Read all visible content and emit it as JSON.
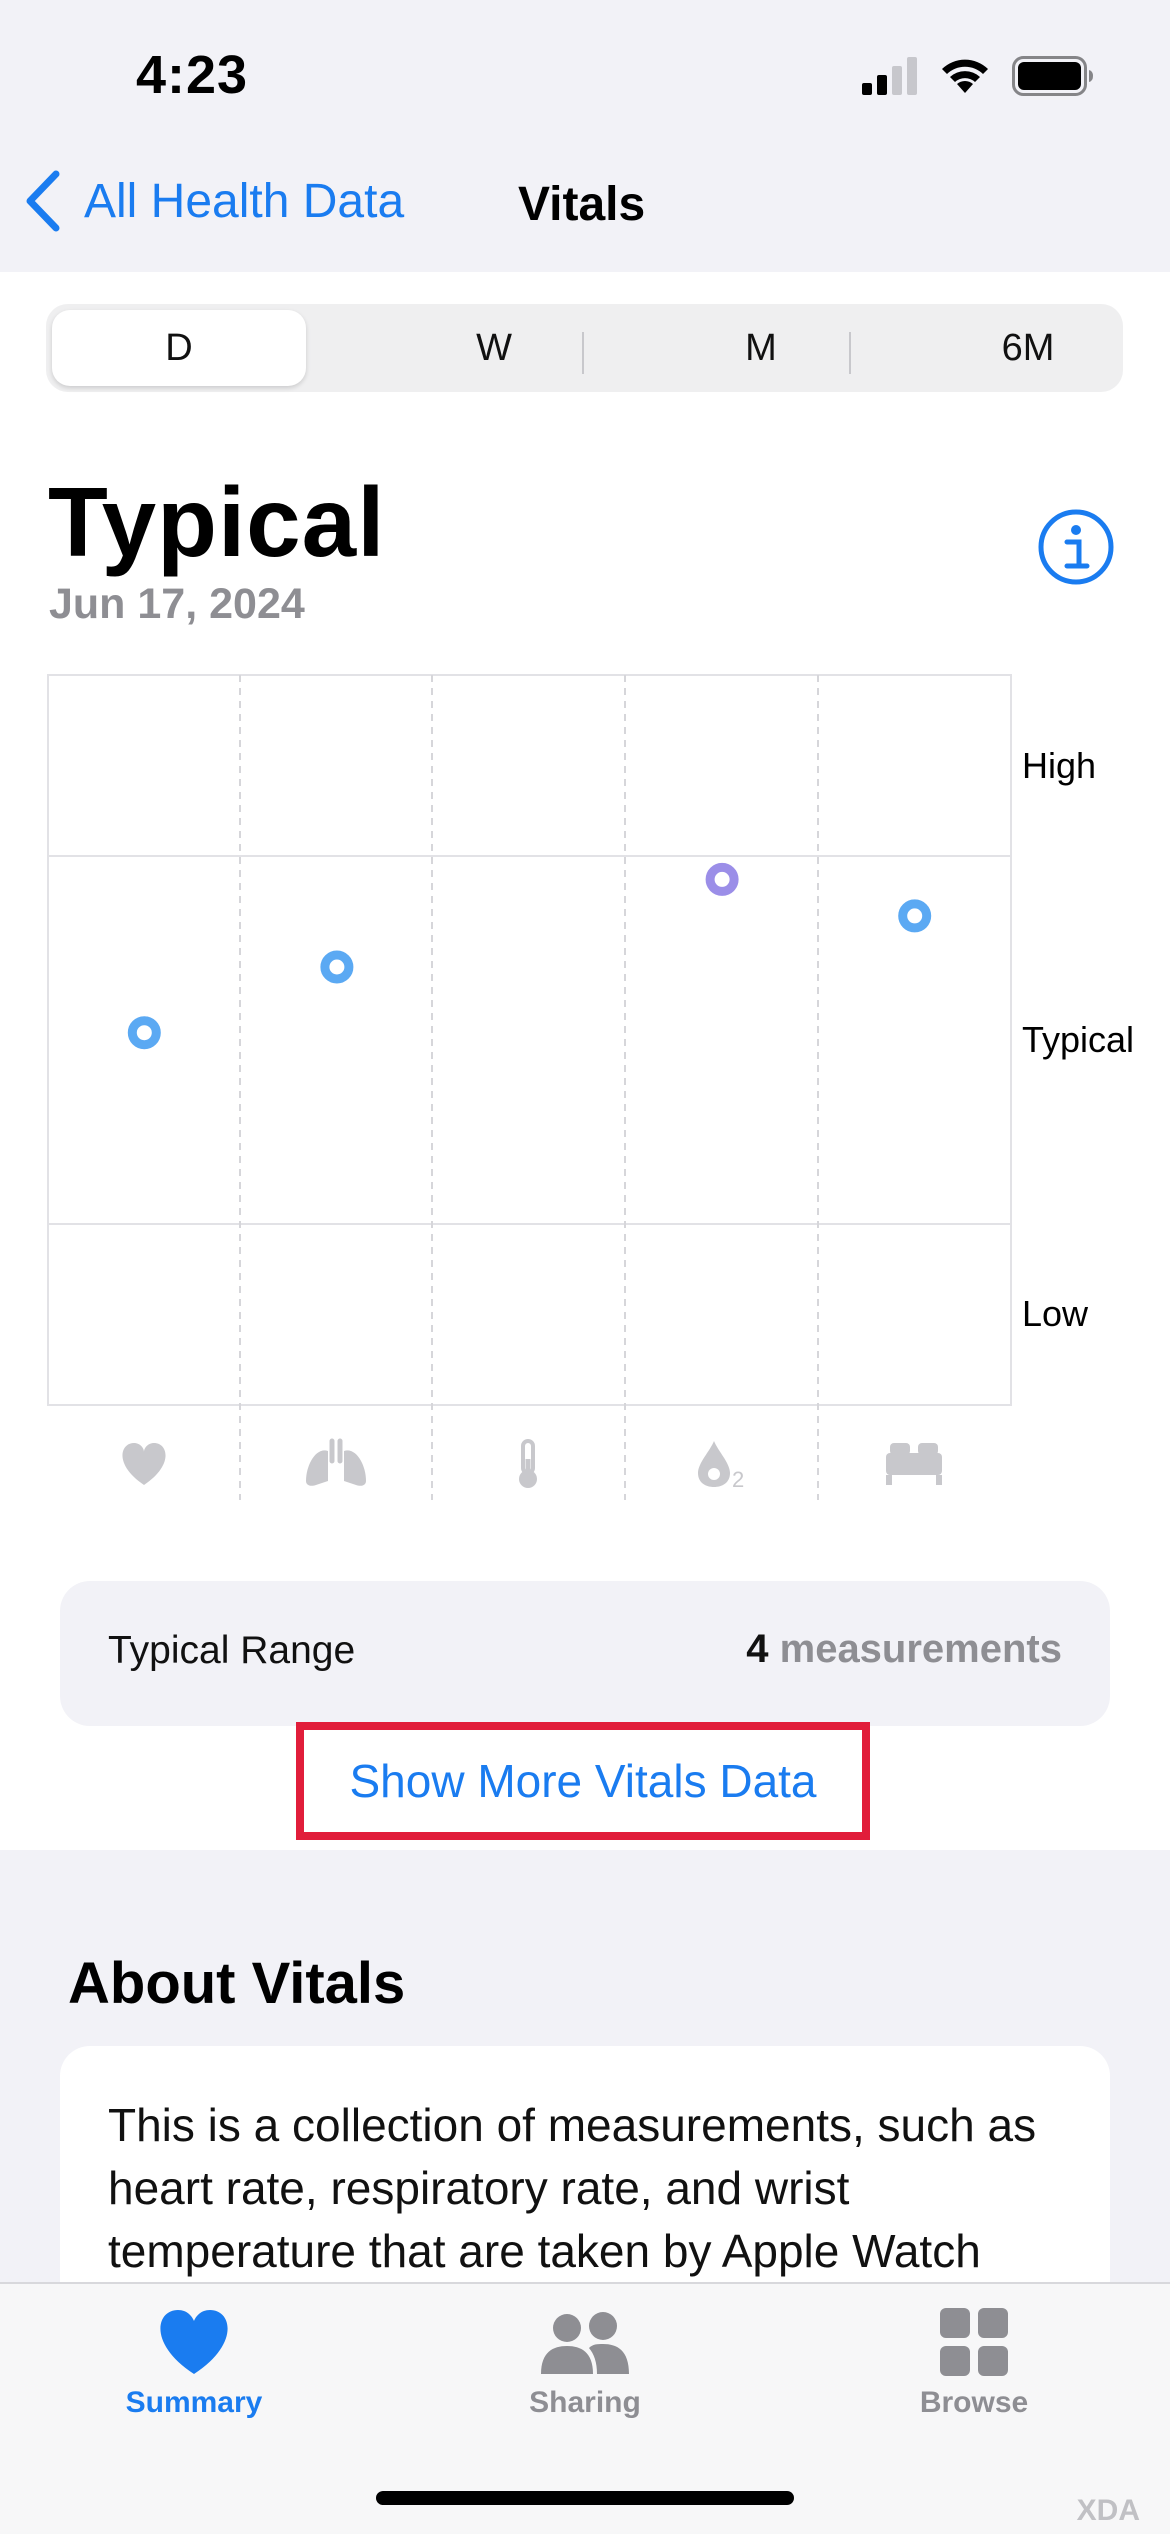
{
  "status_bar": {
    "time": "4:23"
  },
  "nav": {
    "back_label": "All Health Data",
    "title": "Vitals"
  },
  "segments": [
    {
      "label": "D",
      "active": true
    },
    {
      "label": "W",
      "active": false
    },
    {
      "label": "M",
      "active": false
    },
    {
      "label": "6M",
      "active": false
    }
  ],
  "header": {
    "title": "Typical",
    "date": "Jun 17, 2024"
  },
  "chart_data": {
    "type": "scatter",
    "range_labels": [
      "High",
      "Typical",
      "Low"
    ],
    "categories": [
      "heart-icon",
      "lungs-icon",
      "thermometer-icon",
      "blood-oxygen-icon",
      "bed-icon"
    ],
    "points": [
      {
        "category": "heart-icon",
        "value": 0.51,
        "color": "#5ba9f3"
      },
      {
        "category": "lungs-icon",
        "value": 0.6,
        "color": "#5ba9f3"
      },
      {
        "category": "thermometer-icon",
        "value": null,
        "color": "#5ba9f3"
      },
      {
        "category": "blood-oxygen-icon",
        "value": 0.72,
        "color": "#9b8ee8"
      },
      {
        "category": "bed-icon",
        "value": 0.67,
        "color": "#5ba9f3"
      }
    ],
    "grid": true
  },
  "summary": {
    "label": "Typical Range",
    "count": "4",
    "count_unit": "measurements"
  },
  "show_more_label": "Show More Vitals Data",
  "about": {
    "title": "About Vitals",
    "text": "This is a collection of measurements, such as heart rate, respiratory rate, and wrist temperature that are taken by Apple Watch"
  },
  "tabbar": {
    "items": [
      {
        "label": "Summary",
        "icon": "heart-icon",
        "active": true
      },
      {
        "label": "Sharing",
        "icon": "people-icon",
        "active": false
      },
      {
        "label": "Browse",
        "icon": "grid-icon",
        "active": false
      }
    ]
  },
  "watermark": "XDA",
  "colors": {
    "accent": "#1a7cf0",
    "highlight_border": "#e11d3a",
    "point_blue": "#5ba9f3",
    "point_purple": "#9b8ee8"
  }
}
